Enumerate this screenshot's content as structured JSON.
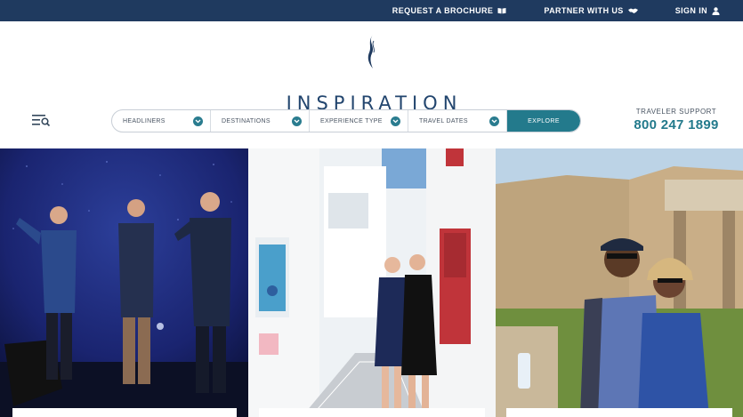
{
  "topbar": {
    "links": [
      {
        "label": "REQUEST A BROCHURE",
        "icon": "book-icon"
      },
      {
        "label": "PARTNER WITH US",
        "icon": "handshake-icon"
      },
      {
        "label": "SIGN IN",
        "icon": "user-icon"
      }
    ]
  },
  "brand": {
    "name": "INSPIRATION",
    "primary_color": "#1f3a5f",
    "accent_color": "#237a8c"
  },
  "search": {
    "filters": [
      {
        "label": "HEADLINERS"
      },
      {
        "label": "DESTINATIONS"
      },
      {
        "label": "EXPERIENCE TYPE"
      },
      {
        "label": "TRAVEL DATES"
      }
    ],
    "explore_label": "EXPLORE"
  },
  "support": {
    "label": "TRAVELER SUPPORT",
    "phone": "800 247 1899"
  },
  "tiles": [
    {
      "name": "concert-performers-image"
    },
    {
      "name": "greek-island-street-image"
    },
    {
      "name": "travelers-ruins-image"
    }
  ]
}
